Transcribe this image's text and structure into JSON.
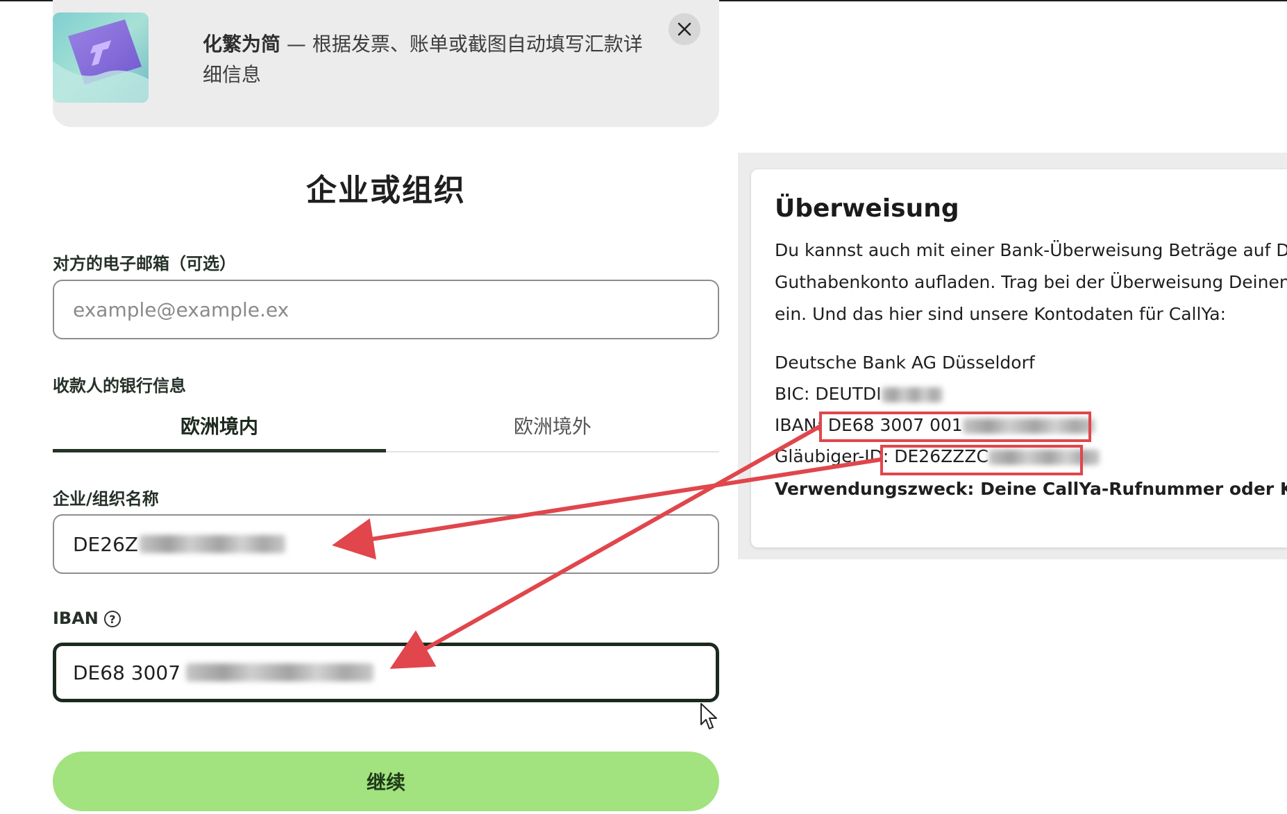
{
  "banner": {
    "title_bold": "化繁为简",
    "title_rest": " — 根据发票、账单或截图自动填写汇款详细信息"
  },
  "form": {
    "title": "企业或组织",
    "email_label": "对方的电子邮箱（可选）",
    "email_placeholder": "example@example.ex",
    "bank_label": "收款人的银行信息",
    "tabs": [
      {
        "label": "欧洲境内",
        "active": true
      },
      {
        "label": "欧洲境外",
        "active": false
      }
    ],
    "company_label": "企业/组织名称",
    "company_value": "DE26Z",
    "iban_label": "IBAN",
    "iban_value": "DE68 3007",
    "continue_label": "继续"
  },
  "transfer_panel": {
    "title": "Überweisung",
    "paragraph_lines": [
      "Du kannst auch mit einer Bank-Überweisung Beträge auf Dein C",
      "Guthabenkonto aufladen. Trag bei der Überweisung Deinen gev",
      "ein. Und das hier sind unsere Kontodaten für CallYa:"
    ],
    "bank_name": "Deutsche Bank AG Düsseldorf",
    "bic_label": "BIC:",
    "bic_value": "DEUTDI",
    "iban_label": "IBAN:",
    "iban_value": "DE68 3007 001",
    "creditor_label": "Gläubiger-ID:",
    "creditor_value": "DE26ZZZC",
    "purpose": "Verwendungszweck: Deine CallYa-Rufnummer oder Kunde"
  },
  "colors": {
    "accent_green": "#a2e27f",
    "dark_green": "#1b2a1e",
    "annotation_red": "#e0464c"
  }
}
